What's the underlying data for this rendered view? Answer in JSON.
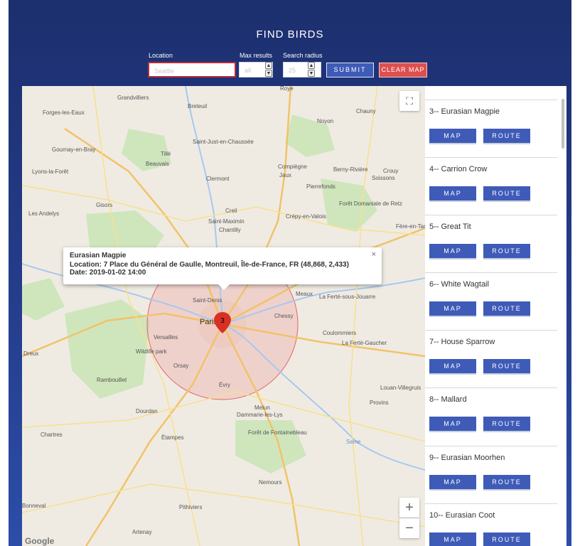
{
  "header": {
    "title": "FIND BIRDS"
  },
  "search": {
    "location_label": "Location",
    "location_placeholder": "Seattle",
    "max_results_label": "Max results",
    "max_results_placeholder": "all",
    "radius_label": "Search radius",
    "radius_placeholder": "25",
    "submit_label": "SUBMIT",
    "clear_label": "CLEAR MAP"
  },
  "map": {
    "popup": {
      "title": "Eurasian Magpie",
      "location_line": "Location: 7 Place du Général de Gaulle, Montreuil, Île-de-France, FR (48,868, 2,433)",
      "date_line": "Date: 2019-01-02 14:00",
      "close_glyph": "×"
    },
    "marker_label": "3",
    "zoom_in_glyph": "+",
    "zoom_out_glyph": "−",
    "google_logo": "Google",
    "places": [
      "Grandvilliers",
      "Breteuil",
      "Roye",
      "Chauny",
      "Forges-les-Eaux",
      "Noyon",
      "Saint-Just-en-Chaussée",
      "Gournay-en-Bray",
      "Tillé",
      "Beauvais",
      "Compiègne",
      "Berny-Rivière",
      "Crouy",
      "Soissons",
      "Lyons-la-Forêt",
      "Clermont",
      "Jaux",
      "Pierrefonds",
      "Gisors",
      "Creil",
      "Forêt Domaniale de Retz",
      "Les Andelys",
      "Saint-Maximin",
      "Chantilly",
      "Crépy-en-Valois",
      "Fère-en-Tar",
      "Saint-Denis",
      "Paris",
      "Meaux",
      "La Ferté-sous-Jouarre",
      "Chessy",
      "Versailles",
      "Coulommiers",
      "La Ferté-Gaucher",
      "Dreux",
      "Wildlife park",
      "Orsay",
      "Évry",
      "Rambouillet",
      "Louan-Villegruis",
      "Melun",
      "Dourdan",
      "Dammarie-les-Lys",
      "Provins",
      "Chartres",
      "Étampes",
      "Forêt de Fontainebleau",
      "Nemours",
      "Bonneval",
      "Pithiviers",
      "Seine",
      "Artenay"
    ]
  },
  "results": {
    "items": [
      {
        "name": "3-- Eurasian Magpie",
        "map_label": "MAP",
        "route_label": "ROUTE"
      },
      {
        "name": "4-- Carrion Crow",
        "map_label": "MAP",
        "route_label": "ROUTE"
      },
      {
        "name": "5-- Great Tit",
        "map_label": "MAP",
        "route_label": "ROUTE"
      },
      {
        "name": "6-- White Wagtail",
        "map_label": "MAP",
        "route_label": "ROUTE"
      },
      {
        "name": "7-- House Sparrow",
        "map_label": "MAP",
        "route_label": "ROUTE"
      },
      {
        "name": "8-- Mallard",
        "map_label": "MAP",
        "route_label": "ROUTE"
      },
      {
        "name": "9-- Eurasian Moorhen",
        "map_label": "MAP",
        "route_label": "ROUTE"
      },
      {
        "name": "10-- Eurasian Coot",
        "map_label": "MAP",
        "route_label": "ROUTE"
      }
    ]
  },
  "colors": {
    "header_bg": "#233a86",
    "button_blue": "#3f5bb8",
    "button_red": "#de4f4f",
    "marker_red": "#d93025"
  }
}
